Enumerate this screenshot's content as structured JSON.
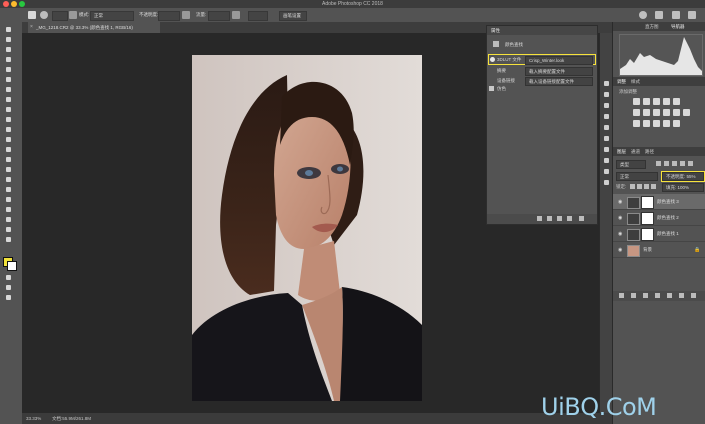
{
  "app": {
    "title": "Adobe Photoshop CC 2018"
  },
  "options_bar": {
    "mode_label": "模式:",
    "mode_value": "正常",
    "opacity_label": "不透明度:",
    "flow_label": "流量:",
    "button_label": "画笔设置"
  },
  "document": {
    "tab_title": "_MG_1218.CR2 @ 33.3% (颜色查找 1, RGB/16)",
    "zoom": "33.33%",
    "doc_size": "文档:55.9M/261.8M"
  },
  "properties": {
    "title": "属性",
    "adjustment_title": "颜色查找",
    "rows": [
      {
        "label": "3DLUT 文件",
        "value": "Crisp_Winter.look"
      },
      {
        "label": "摘要",
        "value": "载入摘要配置文件"
      },
      {
        "label": "设备链接",
        "value": "载入设备链接配置文件"
      }
    ],
    "dither_label": "仿色"
  },
  "right_panels": {
    "top_tabs": [
      "直方图",
      "导航器"
    ],
    "adjust_tabs": [
      "调整",
      "样式"
    ],
    "adjust_heading": "添加调整",
    "layers_tabs": [
      "图层",
      "通道",
      "路径"
    ],
    "kind_label": "类型",
    "blend_mode": "正常",
    "opacity_label": "不透明度: 55%",
    "lock_label": "锁定:",
    "fill_label": "填充: 100%"
  },
  "layers": [
    {
      "name": "颜色查找 3",
      "kind": "adjustment",
      "selected": true
    },
    {
      "name": "颜色查找 2",
      "kind": "adjustment",
      "selected": false
    },
    {
      "name": "颜色查找 1",
      "kind": "adjustment",
      "selected": false
    },
    {
      "name": "背景",
      "kind": "background",
      "selected": false
    }
  ],
  "watermark": "UiBQ.CoM",
  "colors": {
    "foreground": "#f2e23a",
    "background": "#ffffff",
    "highlight": "#f6e23c",
    "watermark": "#9fd1ea"
  }
}
